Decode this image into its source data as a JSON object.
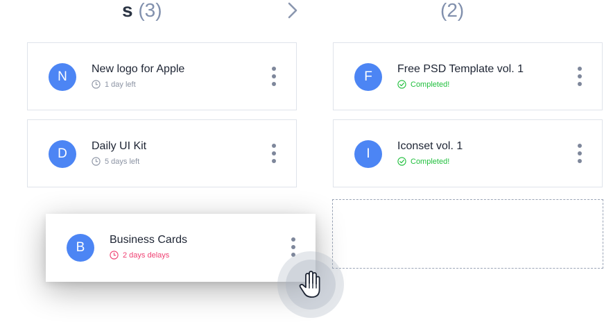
{
  "columns": [
    {
      "title": "s",
      "count": "(3)",
      "cards": [
        {
          "initial": "N",
          "title": "New logo for Apple",
          "status": "1 day left",
          "status_type": "time"
        },
        {
          "initial": "D",
          "title": "Daily UI Kit",
          "status": "5 days left",
          "status_type": "time"
        }
      ]
    },
    {
      "title": "",
      "count": "(2)",
      "cards": [
        {
          "initial": "F",
          "title": "Free PSD Template vol. 1",
          "status": "Completed!",
          "status_type": "done"
        },
        {
          "initial": "I",
          "title": "Iconset vol. 1",
          "status": "Completed!",
          "status_type": "done"
        }
      ]
    }
  ],
  "dragging_card": {
    "initial": "B",
    "title": "Business Cards",
    "status": "2 days delays",
    "status_type": "late"
  },
  "icons": {
    "column_arrow": "chevron-right-icon",
    "time": "clock-icon",
    "done": "check-circle-icon",
    "late": "clock-icon",
    "menu": "more-vertical-icon",
    "cursor": "grab-hand-icon"
  },
  "colors": {
    "avatar": "#4c85f4",
    "done": "#1fbf3c",
    "late": "#ef3f71",
    "muted": "#8b93a3",
    "count": "#8190ad"
  }
}
